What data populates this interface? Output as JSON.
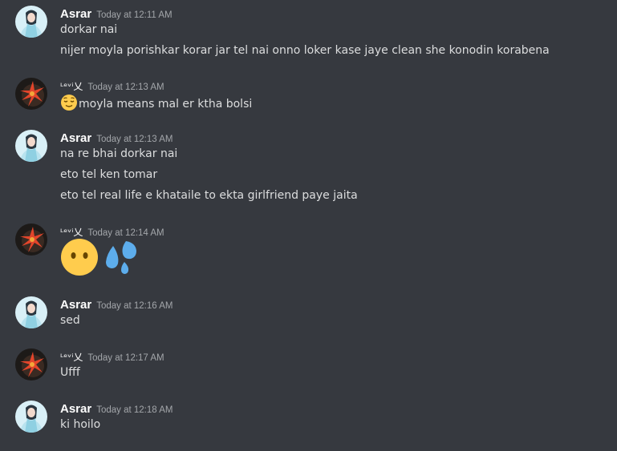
{
  "colors": {
    "background": "#36393f",
    "text": "#dcddde",
    "username": "#ffffff",
    "timestamp": "#a3a6aa"
  },
  "messages": [
    {
      "author": "Asrar",
      "timestamp": "Today at 12:11 AM",
      "avatar": "asrar-avatar",
      "lines": [
        "dorkar nai",
        "nijer moyla porishkar korar jar tel nai onno loker kase jaye clean she konodin korabena"
      ]
    },
    {
      "author": "ᴸᵉᵛⁱ乂",
      "timestamp": "Today at 12:13 AM",
      "avatar": "levi-avatar",
      "emoji": "relieved-face-emoji",
      "lines": [
        "moyla means mal er ktha bolsi"
      ]
    },
    {
      "author": "Asrar",
      "timestamp": "Today at 12:13 AM",
      "avatar": "asrar-avatar",
      "lines": [
        "na re bhai dorkar nai",
        "eto tel ken tomar",
        "eto tel real life e khataile to ekta girlfriend paye jaita"
      ]
    },
    {
      "author": "ᴸᵉᵛⁱ乂",
      "timestamp": "Today at 12:14 AM",
      "avatar": "levi-avatar",
      "jumbo_emojis": [
        "no-mouth-face-emoji",
        "sweat-droplets-emoji"
      ]
    },
    {
      "author": "Asrar",
      "timestamp": "Today at 12:16 AM",
      "avatar": "asrar-avatar",
      "lines": [
        "sed"
      ]
    },
    {
      "author": "ᴸᵉᵛⁱ乂",
      "timestamp": "Today at 12:17 AM",
      "avatar": "levi-avatar",
      "lines": [
        "Ufff"
      ]
    },
    {
      "author": "Asrar",
      "timestamp": "Today at 12:18 AM",
      "avatar": "asrar-avatar",
      "lines": [
        "ki hoilo"
      ]
    }
  ]
}
